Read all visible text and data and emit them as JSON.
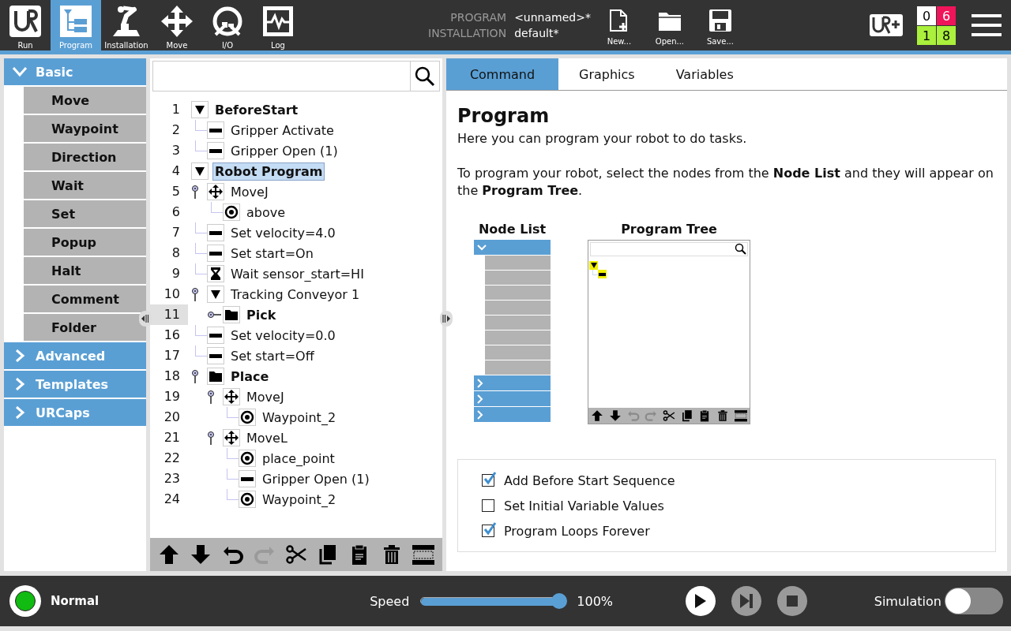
{
  "header": {
    "nav": [
      {
        "kind": "logo",
        "label": "Run",
        "selected": false
      },
      {
        "kind": "program",
        "label": "Program",
        "selected": true
      },
      {
        "kind": "installation",
        "label": "Installation",
        "selected": false
      },
      {
        "kind": "move",
        "label": "Move",
        "selected": false
      },
      {
        "kind": "io",
        "label": "I/O",
        "selected": false
      },
      {
        "kind": "log",
        "label": "Log",
        "selected": false
      }
    ],
    "info": [
      {
        "label": "PROGRAM",
        "value": "<unnamed>*"
      },
      {
        "label": "INSTALLATION",
        "value": "default*"
      }
    ],
    "file_actions": [
      {
        "kind": "new",
        "label": "New..."
      },
      {
        "kind": "open",
        "label": "Open..."
      },
      {
        "kind": "save",
        "label": "Save..."
      }
    ],
    "counters": [
      {
        "text": "0",
        "color": "#ffffff"
      },
      {
        "text": "6",
        "color": "#f0145a"
      },
      {
        "text": "1",
        "color": "#aaf03c"
      },
      {
        "text": "8",
        "color": "#aaf03c"
      }
    ]
  },
  "sidebar": {
    "sections": [
      {
        "label": "Basic",
        "expanded": true,
        "items": [
          "Move",
          "Waypoint",
          "Direction",
          "Wait",
          "Set",
          "Popup",
          "Halt",
          "Comment",
          "Folder"
        ]
      },
      {
        "label": "Advanced",
        "expanded": false
      },
      {
        "label": "Templates",
        "expanded": false
      },
      {
        "label": "URCaps",
        "expanded": false
      }
    ]
  },
  "tree": {
    "nodes": [
      {
        "number": "1",
        "label": "BeforeStart",
        "kind": "toggle",
        "bold": true,
        "selected": false,
        "current": false,
        "children": [
          {
            "number": "2",
            "label": "Gripper Activate",
            "kind": "action",
            "bold": false,
            "selected": false,
            "current": false
          },
          {
            "number": "3",
            "label": "Gripper Open (1)",
            "kind": "action",
            "bold": false,
            "selected": false,
            "current": false
          }
        ]
      },
      {
        "number": "4",
        "label": "Robot Program",
        "kind": "toggle",
        "bold": true,
        "selected": true,
        "current": false,
        "children": [
          {
            "number": "5",
            "label": "MoveJ",
            "kind": "move",
            "bold": false,
            "selected": false,
            "current": false,
            "expanded": true,
            "children": [
              {
                "number": "6",
                "label": "above",
                "kind": "waypoint",
                "bold": false,
                "selected": false,
                "current": false
              }
            ]
          },
          {
            "number": "7",
            "label": "Set velocity=4.0",
            "kind": "action",
            "bold": false,
            "selected": false,
            "current": false
          },
          {
            "number": "8",
            "label": "Set start=On",
            "kind": "action",
            "bold": false,
            "selected": false,
            "current": false
          },
          {
            "number": "9",
            "label": "Wait sensor_start=HI",
            "kind": "wait",
            "bold": false,
            "selected": false,
            "current": false
          },
          {
            "number": "10",
            "label": "Tracking Conveyor 1",
            "kind": "toggle",
            "bold": false,
            "selected": false,
            "current": false,
            "expanded": true,
            "children": [
              {
                "number": "11",
                "label": "Pick",
                "kind": "folder",
                "bold": true,
                "selected": false,
                "current": true,
                "expanded": false
              }
            ]
          },
          {
            "number": "16",
            "label": "Set velocity=0.0",
            "kind": "action",
            "bold": false,
            "selected": false,
            "current": false
          },
          {
            "number": "17",
            "label": "Set start=Off",
            "kind": "action",
            "bold": false,
            "selected": false,
            "current": false
          },
          {
            "number": "18",
            "label": "Place",
            "kind": "folder",
            "bold": true,
            "selected": false,
            "current": false,
            "expanded": true,
            "children": [
              {
                "number": "19",
                "label": "MoveJ",
                "kind": "move",
                "bold": false,
                "selected": false,
                "current": false,
                "expanded": true,
                "children": [
                  {
                    "number": "20",
                    "label": "Waypoint_2",
                    "kind": "waypoint",
                    "bold": false,
                    "selected": false,
                    "current": false
                  }
                ]
              },
              {
                "number": "21",
                "label": "MoveL",
                "kind": "move",
                "bold": false,
                "selected": false,
                "current": false,
                "expanded": true,
                "children": [
                  {
                    "number": "22",
                    "label": "place_point",
                    "kind": "waypoint",
                    "bold": false,
                    "selected": false,
                    "current": false
                  },
                  {
                    "number": "23",
                    "label": "Gripper Open (1)",
                    "kind": "action",
                    "bold": false,
                    "selected": false,
                    "current": false
                  },
                  {
                    "number": "24",
                    "label": "Waypoint_2",
                    "kind": "waypoint",
                    "bold": false,
                    "selected": false,
                    "current": false
                  }
                ]
              }
            ]
          }
        ]
      }
    ],
    "toolbar": [
      {
        "kind": "up",
        "disabled": false
      },
      {
        "kind": "down",
        "disabled": false
      },
      {
        "kind": "undo",
        "disabled": false
      },
      {
        "kind": "redo",
        "disabled": true
      },
      {
        "kind": "cut",
        "disabled": false
      },
      {
        "kind": "copy",
        "disabled": false
      },
      {
        "kind": "paste",
        "disabled": false
      },
      {
        "kind": "delete",
        "disabled": false
      },
      {
        "kind": "suppress",
        "disabled": false
      }
    ]
  },
  "command": {
    "tabs": [
      {
        "label": "Command",
        "selected": true
      },
      {
        "label": "Graphics",
        "selected": false
      },
      {
        "label": "Variables",
        "selected": false
      }
    ],
    "heading": "Program",
    "intro": "Here you can program your robot to do tasks.",
    "instructions": "To program your robot, select the nodes from the **Node List** and they will appear on the **Program Tree**.",
    "node_list_title": "Node List",
    "program_tree_title": "Program Tree",
    "options": [
      {
        "label": "Add Before Start Sequence",
        "checked": true
      },
      {
        "label": "Set Initial Variable Values",
        "checked": false
      },
      {
        "label": "Program Loops Forever",
        "checked": true
      }
    ]
  },
  "footer": {
    "status": {
      "label": "Normal",
      "color": "#11bb11"
    },
    "speed": {
      "label": "Speed",
      "level": 1.0,
      "reading": "100%"
    },
    "controls": [
      {
        "kind": "play",
        "disabled": false
      },
      {
        "kind": "step",
        "disabled": true
      },
      {
        "kind": "stop",
        "disabled": true
      }
    ],
    "simulation": {
      "label": "Simulation",
      "on": false
    }
  }
}
